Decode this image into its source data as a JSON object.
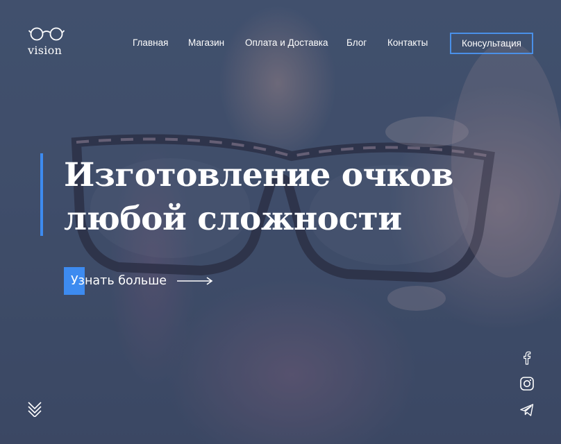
{
  "logo": {
    "text": "vision",
    "icon": "glasses-icon"
  },
  "nav": {
    "items": [
      {
        "label": "Главная"
      },
      {
        "label": "Магазин"
      },
      {
        "label": "Оплата и Доставка"
      },
      {
        "label": "Блог"
      },
      {
        "label": "Контакты"
      }
    ],
    "consult_label": "Консультация"
  },
  "hero": {
    "title_line1": "Изготовление очков",
    "title_line2": "любой сложности",
    "more_label": "Узнать больше"
  },
  "scroll": {
    "icon": "double-chevron-down-icon"
  },
  "social": [
    "facebook-icon",
    "instagram-icon",
    "telegram-icon"
  ],
  "colors": {
    "accent": "#3d8bf0",
    "overlay": "#35456e"
  }
}
